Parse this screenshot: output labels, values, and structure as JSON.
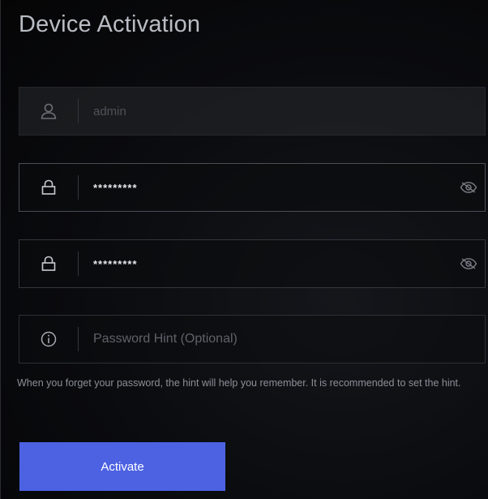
{
  "dialog": {
    "title": "Device Activation"
  },
  "fields": {
    "username": {
      "value": "admin",
      "icon": "user-icon"
    },
    "password": {
      "value": "*********",
      "icon": "lock-icon",
      "toggle_icon": "eye-hidden-icon"
    },
    "confirm_password": {
      "value": "*********",
      "icon": "lock-icon",
      "toggle_icon": "eye-hidden-icon"
    },
    "hint": {
      "placeholder": "Password Hint (Optional)",
      "icon": "info-icon"
    }
  },
  "helper_text": "When you forget your password, the hint will help you remember. It is recommended to set the hint.",
  "actions": {
    "activate_label": "Activate"
  },
  "colors": {
    "accent": "#4c62e3",
    "background": "#0a0b0e",
    "text": "#c8cad0"
  }
}
